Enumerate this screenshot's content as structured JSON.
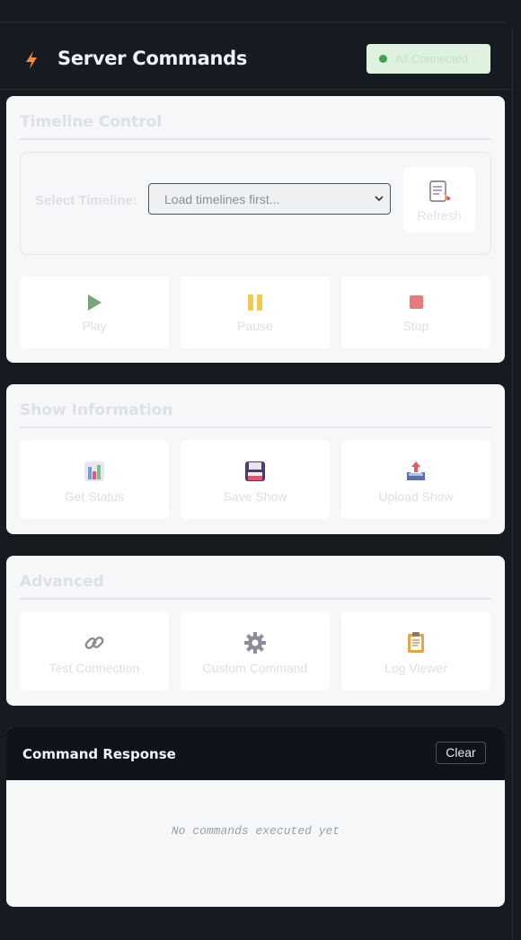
{
  "header": {
    "title": "Server Commands",
    "status_text": "All Connected",
    "icon": "lightning-bolt-icon"
  },
  "timeline": {
    "section_title": "Timeline Control",
    "select_label": "Select Timeline:",
    "select_value": "Load timelines first...",
    "refresh_label": "Refresh",
    "buttons": [
      {
        "label": "Play",
        "icon": "play-icon"
      },
      {
        "label": "Pause",
        "icon": "pause-icon"
      },
      {
        "label": "Stop",
        "icon": "stop-icon"
      }
    ]
  },
  "show_info": {
    "section_title": "Show Information",
    "buttons": [
      {
        "label": "Get Status",
        "icon": "bar-chart-icon"
      },
      {
        "label": "Save Show",
        "icon": "floppy-disk-icon"
      },
      {
        "label": "Upload Show",
        "icon": "upload-tray-icon"
      }
    ]
  },
  "advanced": {
    "section_title": "Advanced",
    "buttons": [
      {
        "label": "Test Connection",
        "icon": "link-icon"
      },
      {
        "label": "Custom Command",
        "icon": "gear-icon"
      },
      {
        "label": "Log Viewer",
        "icon": "clipboard-icon"
      }
    ]
  },
  "response": {
    "title": "Command Response",
    "clear_label": "Clear",
    "empty_text": "No commands executed yet"
  },
  "colors": {
    "background": "#161b22",
    "status_ok": "#3fa34d",
    "accent_orange": "#f0883e"
  }
}
